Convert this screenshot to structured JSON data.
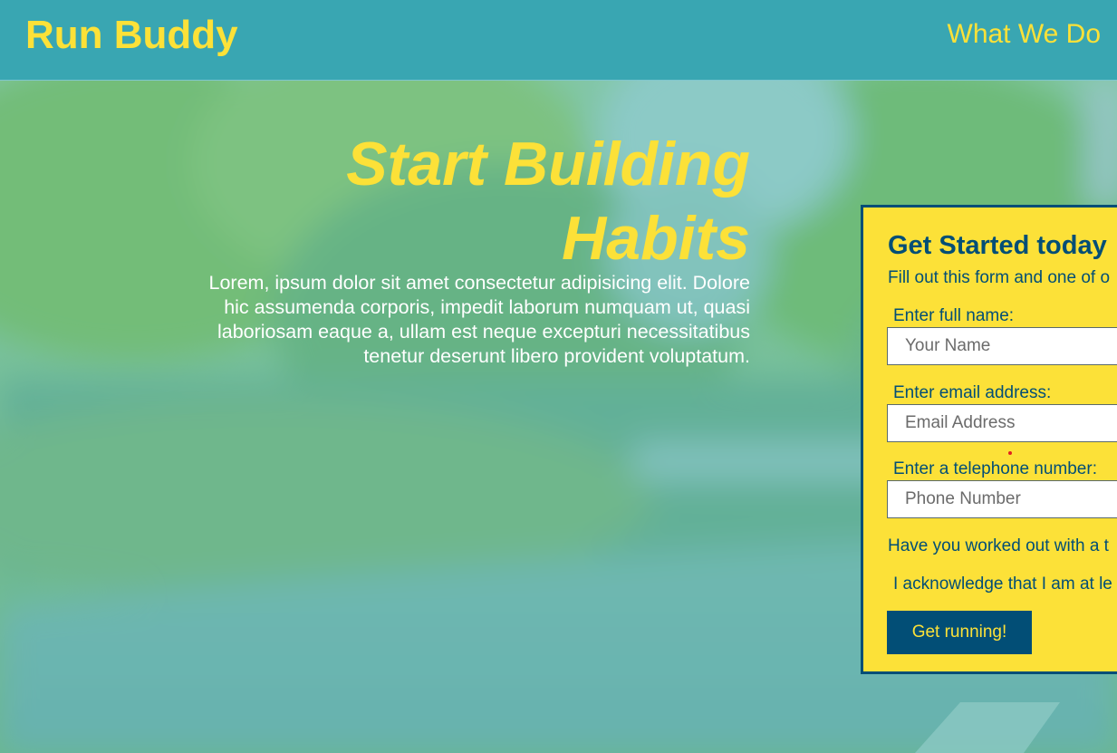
{
  "header": {
    "logo": "Run Buddy",
    "nav": [
      {
        "label": "What We Do"
      }
    ]
  },
  "hero": {
    "heading_line1": "Start Building",
    "heading_line2": "Habits",
    "body": "Lorem, ipsum dolor sit amet consectetur adipisicing elit. Dolore hic assumenda corporis, impedit laborum numquam ut, quasi laboriosam eaque a, ullam est neque excepturi necessitatibus tenetur deserunt libero provident voluptatum."
  },
  "form": {
    "title": "Get Started today",
    "subtitle": "Fill out this form and one of o",
    "fields": [
      {
        "label": "Enter full name:",
        "placeholder": "Your Name",
        "value": ""
      },
      {
        "label": "Enter email address:",
        "placeholder": "Email Address",
        "value": ""
      },
      {
        "label": "Enter a telephone number:",
        "placeholder": "Phone Number",
        "value": ""
      }
    ],
    "question": "Have you worked out with a t",
    "acknowledge": "I acknowledge that I am at le",
    "submit_label": "Get running!"
  },
  "colors": {
    "primary": "#39a6b2",
    "accent": "#fce138",
    "dark": "#024e76"
  }
}
